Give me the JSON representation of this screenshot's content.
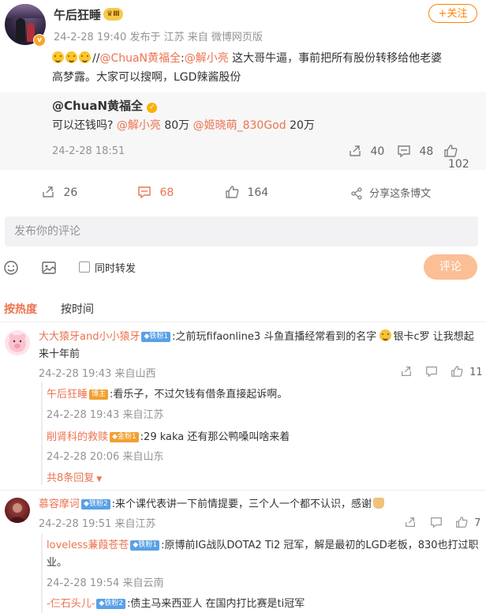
{
  "post": {
    "author": "午后狂睡",
    "level_badge": "Ⅲ",
    "v_badge": "v",
    "follow_label": "+关注",
    "meta": "24-2-28 19:40 发布于 江苏  来自 微博网页版",
    "text_prefix": "//",
    "mention1": "@ChuaN黄福全",
    "colon": ":",
    "mention2": "@解小亮",
    "text_line1": " 这大哥牛逼，事前把所有股份转移给他老婆",
    "text_line2": "高梦露。大家可以搜啊，LGD辣酱股份",
    "repost": {
      "author": "@ChuaN黄福全",
      "text_a": "可以还钱吗?  ",
      "mention_a": "@解小亮",
      "text_b": " 80万  ",
      "mention_b": "@姬晓萌_830God",
      "text_c": " 20万",
      "time": "24-2-28 18:51",
      "reposts": "40",
      "comments": "48",
      "likes": "102"
    },
    "actions": {
      "reposts": "26",
      "comments": "68",
      "likes": "164",
      "share": "分享这条博文"
    }
  },
  "composer": {
    "placeholder": "发布你的评论",
    "also_repost": "同时转发",
    "submit": "评论"
  },
  "sort": {
    "hot": "按热度",
    "time": "按时间"
  },
  "comments": [
    {
      "name": "大大猿牙and小小猿牙",
      "level": "铁粉1",
      "text_line1": ":之前玩fifaonline3 斗鱼直播经常看到的名字",
      "text_line1b": "银卡c罗 让我想起",
      "text_line2": "来十年前",
      "meta": "24-2-28 19:43 来自山西",
      "likes": "11",
      "replies": [
        {
          "name": "午后狂睡",
          "badge": "博主",
          "text": ":看乐子，不过欠钱有借条直接起诉啊。",
          "meta": "24-2-28 19:43 来自江苏"
        },
        {
          "name": "削肾科的救赎",
          "badge": "金粉1",
          "text": ":29  kaka 还有那公鸭嗓叫啥来着",
          "meta": "24-2-28 20:06 来自山东"
        }
      ],
      "more_replies": "共8条回复"
    },
    {
      "name": "慕容摩诃",
      "level": "铁粉2",
      "text_line1": ":来个课代表讲一下前情提要，三个人一个都不认识，感谢",
      "meta": "24-2-28 19:51 来自江苏",
      "likes": "7",
      "replies": [
        {
          "name": "loveless蒹葭苍苍",
          "badge": "铁粉1",
          "text_line1": ":原博前IG战队DOTA2 Ti2 冠军，解是最初的LGD老板，830也打过职",
          "text_line2": "业。",
          "meta": "24-2-28 19:54 来自云南"
        },
        {
          "name": "-仨石头儿-",
          "badge": "铁粉2",
          "text": ":债主马来西亚人 在国内打比赛是ti冠军"
        }
      ]
    }
  ],
  "colors": {
    "accent": "#eb7350",
    "follow": "#ff8200",
    "link": "#eb7350"
  }
}
